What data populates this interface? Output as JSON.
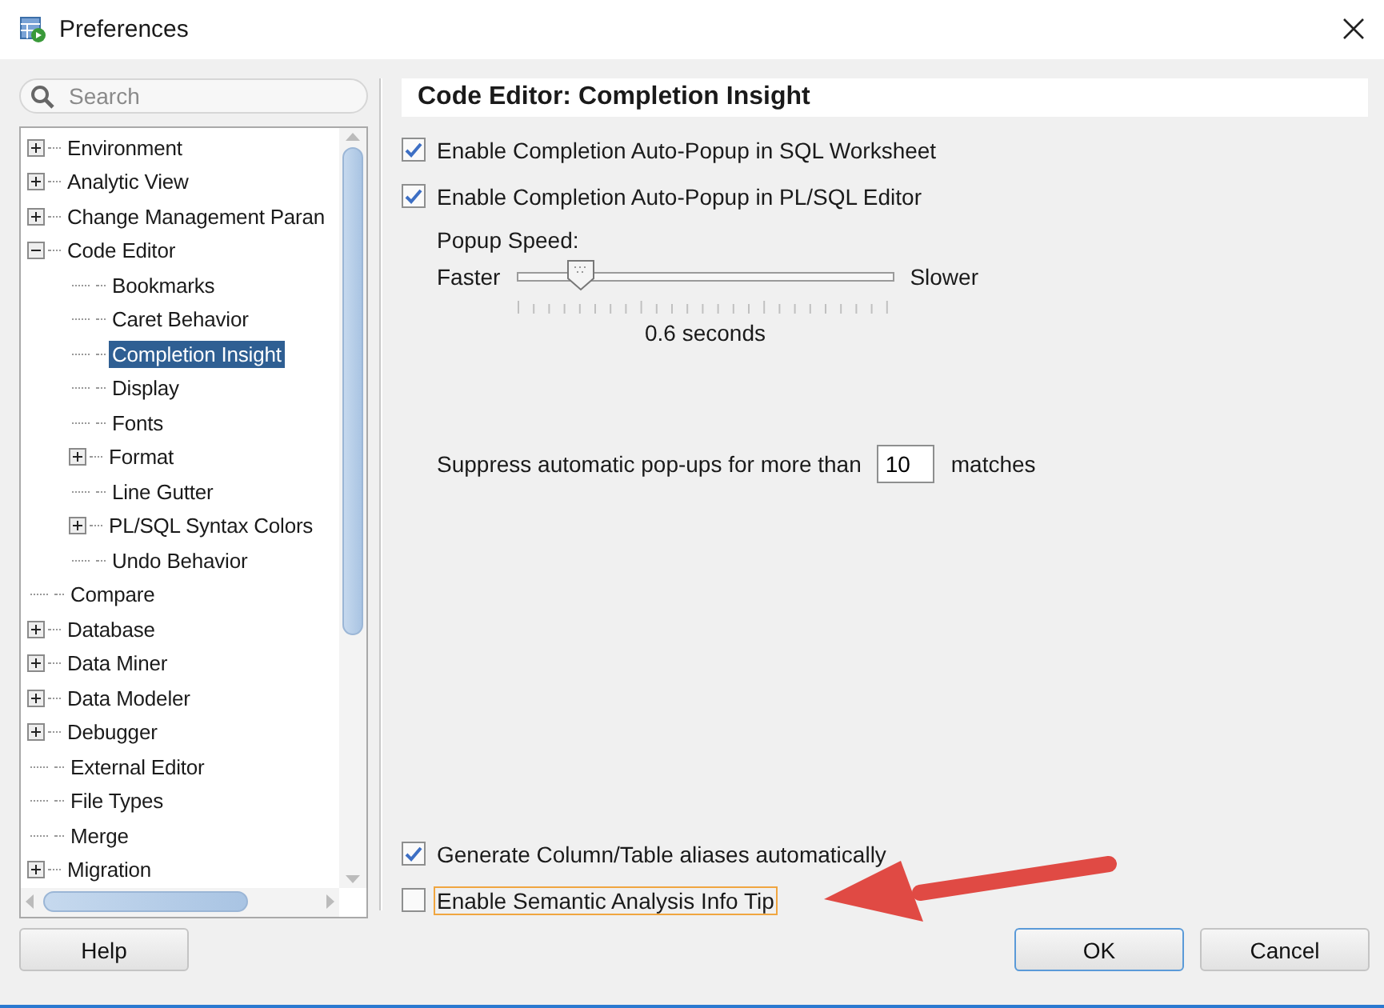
{
  "window": {
    "title": "Preferences"
  },
  "search": {
    "placeholder": "Search"
  },
  "tree": [
    {
      "label": "Environment",
      "expanded": false,
      "selected": false
    },
    {
      "label": "Analytic View",
      "expanded": false,
      "selected": false
    },
    {
      "label": "Change Management Paran",
      "expanded": false,
      "selected": false
    },
    {
      "label": "Code Editor",
      "expanded": true,
      "selected": false,
      "children": [
        {
          "label": "Bookmarks",
          "selected": false
        },
        {
          "label": "Caret Behavior",
          "selected": false
        },
        {
          "label": "Completion Insight",
          "selected": true
        },
        {
          "label": "Display",
          "selected": false
        },
        {
          "label": "Fonts",
          "selected": false
        },
        {
          "label": "Format",
          "expanded": false,
          "selected": false
        },
        {
          "label": "Line Gutter",
          "selected": false
        },
        {
          "label": "PL/SQL Syntax Colors",
          "expanded": false,
          "selected": false
        },
        {
          "label": "Undo Behavior",
          "selected": false
        }
      ]
    },
    {
      "label": "Compare",
      "selected": false
    },
    {
      "label": "Database",
      "expanded": false,
      "selected": false
    },
    {
      "label": "Data Miner",
      "expanded": false,
      "selected": false
    },
    {
      "label": "Data Modeler",
      "expanded": false,
      "selected": false
    },
    {
      "label": "Debugger",
      "expanded": false,
      "selected": false
    },
    {
      "label": "External Editor",
      "selected": false
    },
    {
      "label": "File Types",
      "selected": false
    },
    {
      "label": "Merge",
      "selected": false
    },
    {
      "label": "Migration",
      "expanded": false,
      "selected": false
    }
  ],
  "panel": {
    "title": "Code Editor: Completion Insight",
    "options": [
      {
        "label": "Enable Completion Auto-Popup in SQL Worksheet",
        "checked": true
      },
      {
        "label": "Enable Completion Auto-Popup in PL/SQL Editor",
        "checked": true
      }
    ],
    "popup_speed": {
      "label": "Popup Speed:",
      "min_label": "Faster",
      "max_label": "Slower",
      "level": 0.17,
      "reading": "0.6 seconds"
    },
    "suppress": {
      "before": "Suppress automatic pop-ups for more than",
      "value": "10",
      "after": "matches"
    },
    "bottom_options": [
      {
        "label": "Generate Column/Table aliases automatically",
        "checked": true,
        "focused": false
      },
      {
        "label": "Enable Semantic Analysis Info Tip",
        "checked": false,
        "focused": true
      }
    ]
  },
  "buttons": [
    {
      "label": "Help",
      "default": false
    },
    {
      "label": "OK",
      "default": true
    },
    {
      "label": "Cancel",
      "default": false
    }
  ]
}
